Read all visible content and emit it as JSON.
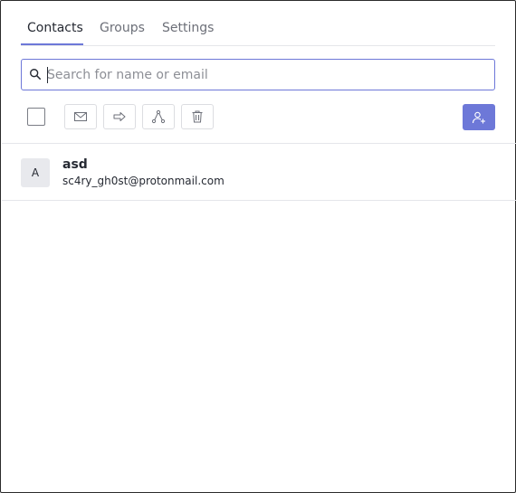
{
  "tabs": [
    {
      "label": "Contacts",
      "active": true
    },
    {
      "label": "Groups",
      "active": false
    },
    {
      "label": "Settings",
      "active": false
    }
  ],
  "search": {
    "placeholder": "Search for name or email",
    "value": "",
    "icon": "search-icon"
  },
  "toolbar": {
    "select_all_checked": false,
    "buttons": [
      {
        "name": "email-button",
        "icon": "envelope-icon"
      },
      {
        "name": "export-button",
        "icon": "arrow-right-icon"
      },
      {
        "name": "merge-button",
        "icon": "merge-icon"
      },
      {
        "name": "delete-button",
        "icon": "trash-icon"
      }
    ],
    "add_button_icon": "add-user-icon"
  },
  "contacts": [
    {
      "initial": "A",
      "name": "asd",
      "email": "sc4ry_gh0st@protonmail.com"
    }
  ],
  "colors": {
    "accent": "#6d78d8",
    "text": "#262a33",
    "muted": "#6c6f78",
    "border": "#e5e6ea",
    "avatar_bg": "#e8e9ed"
  }
}
